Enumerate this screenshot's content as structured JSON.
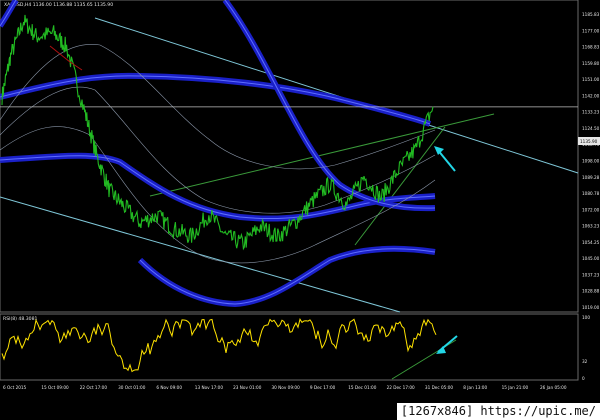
{
  "header": {
    "symbol_line": "XAUUSD,H4  1136.00 1136.88 1135.65 1135.90"
  },
  "indicator": {
    "label": "RSI(8) 48.3081",
    "scale": {
      "top": "100",
      "mid": "32",
      "bottom": "0"
    }
  },
  "price_axis": {
    "labels": [
      "1185.83",
      "1177.00",
      "1168.83",
      "1159.80",
      "1151.00",
      "1142.00",
      "1133.23",
      "1124.50",
      "1108.75",
      "1098.00",
      "1089.28",
      "1080.78",
      "1072.00",
      "1063.23",
      "1054.25",
      "1045.00",
      "1037.23",
      "1028.88",
      "1019.00"
    ],
    "current_price_label": "1135.90",
    "current_price_value": 1135.9
  },
  "time_axis": {
    "labels": [
      "6 Oct 2015",
      "15 Oct 09:00",
      "22 Oct 17:00",
      "30 Oct 01:00",
      "6 Nov 09:00",
      "13 Nov 17:00",
      "23 Nov 01:00",
      "30 Nov 09:00",
      "9 Dec 17:00",
      "15 Dec 01:00",
      "22 Dec 17:00",
      "31 Dec 05:00",
      "8 Jan 13:00",
      "15 Jan 21:00",
      "26 Jan 05:00"
    ]
  },
  "colors": {
    "background": "#000000",
    "price_line": "#22bb22",
    "band": "#2a2fd8",
    "band_highlight": "#5c6bff",
    "channel": "#7fc7d8",
    "trend_green": "#3a9a3a",
    "rsi": "#ffe300",
    "arrow": "#22d6e6",
    "text": "#e6e6e6"
  },
  "watermark": "[1267x846] https://upic.me/",
  "chart_data": {
    "type": "line",
    "title": "XAUUSD,H4  1136.00 1136.88 1135.65 1135.90",
    "price_range": [
      1019.0,
      1190.0
    ],
    "x_ticks": [
      "6 Oct 2015",
      "15 Oct 09:00",
      "22 Oct 17:00",
      "30 Oct 01:00",
      "6 Nov 09:00",
      "13 Nov 17:00",
      "23 Nov 01:00",
      "30 Nov 09:00",
      "9 Dec 17:00",
      "15 Dec 01:00",
      "22 Dec 17:00",
      "31 Dec 05:00",
      "8 Jan 13:00",
      "15 Jan 21:00",
      "26 Jan 05:00"
    ],
    "series": [
      {
        "name": "XAUUSD",
        "x": [
          0,
          0.02,
          0.05,
          0.08,
          0.12,
          0.15,
          0.19,
          0.22,
          0.25,
          0.28,
          0.32,
          0.36,
          0.4,
          0.44,
          0.48,
          0.52,
          0.56,
          0.6,
          0.64,
          0.68,
          0.72,
          0.76,
          0.8,
          0.84,
          0.88,
          0.92,
          0.96,
          1.0
        ],
        "values": [
          1142,
          1165,
          1185,
          1176,
          1178,
          1170,
          1135,
          1108,
          1088,
          1080,
          1070,
          1074,
          1066,
          1062,
          1075,
          1062,
          1058,
          1068,
          1062,
          1070,
          1082,
          1092,
          1080,
          1096,
          1084,
          1100,
          1112,
          1136
        ]
      }
    ],
    "rsi": {
      "name": "RSI(8)",
      "current": 48.3081,
      "ylim": [
        0,
        100
      ],
      "levels": [
        100,
        32
      ]
    }
  }
}
